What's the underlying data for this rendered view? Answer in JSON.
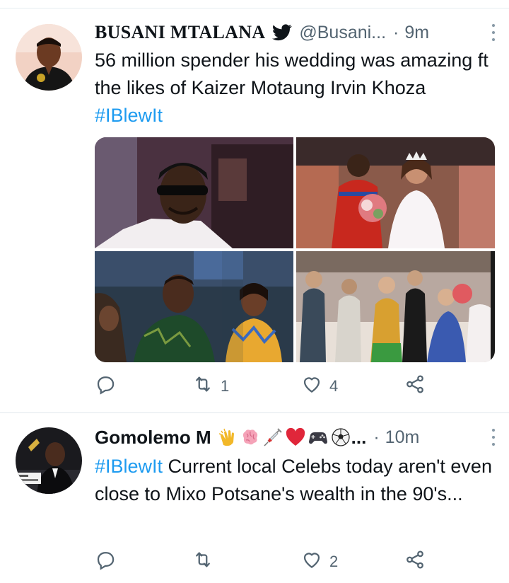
{
  "tweets": [
    {
      "author": "BUSANI MTALANA",
      "handle": "@Busani...",
      "separator": "·",
      "time": "9m",
      "text_plain": "56 million spender his wedding was amazing ft the likes of Kaizer Motaung Irvin Khoza ",
      "hashtag": "#IBlewIt",
      "reply_count": "",
      "retweet_count": "1",
      "like_count": "4"
    },
    {
      "author": "Gomolemo M",
      "name_suffix": "...",
      "separator": "·",
      "time": "10m",
      "hashtag": "#IBlewIt",
      "text_plain": " Current local Celebs today aren't even close to Mixo Potsane's wealth in the 90's...",
      "reply_count": "",
      "retweet_count": "",
      "like_count": "2"
    }
  ],
  "icons": {
    "verified": "twitter-bird-icon",
    "reply": "reply-icon",
    "retweet": "retweet-icon",
    "like": "heart-icon",
    "share": "share-icon",
    "more": "more-vertical-icon"
  },
  "colors": {
    "hashtag": "#1d9bf0",
    "secondary_text": "#536471"
  }
}
